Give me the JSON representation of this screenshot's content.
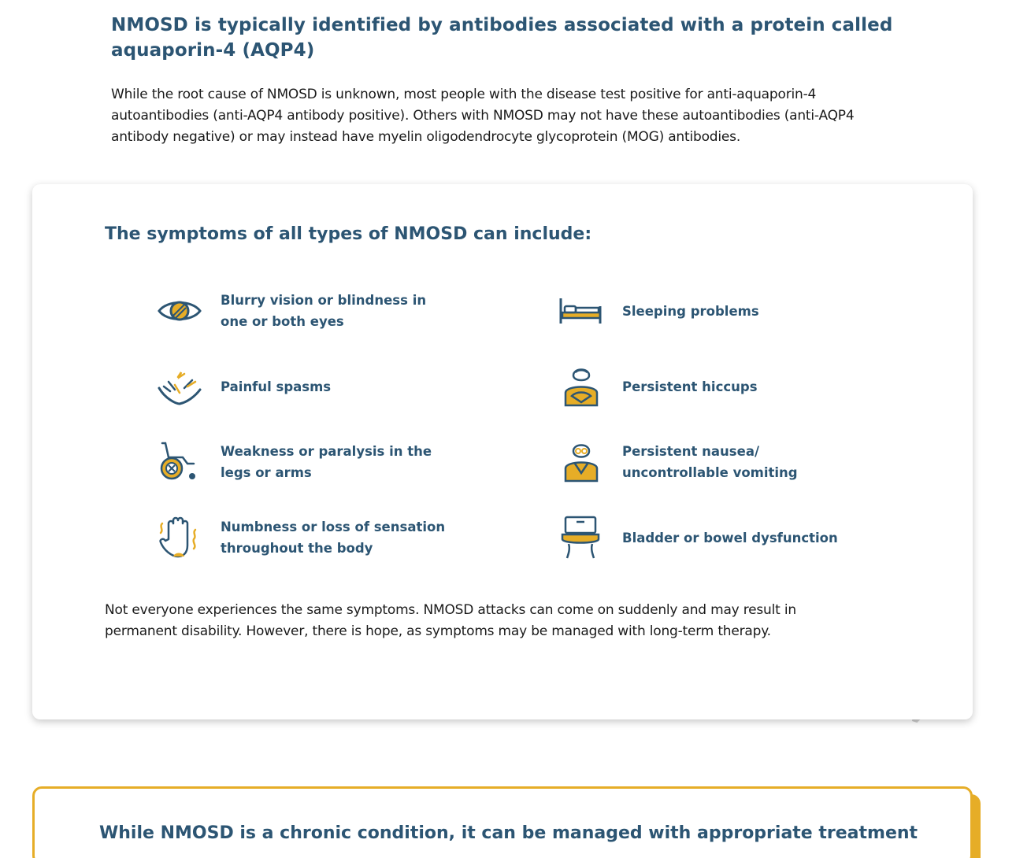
{
  "intro": {
    "heading": "NMOSD is typically identified by antibodies associated with a protein called aquaporin-4 (AQP4)",
    "body": "While the root cause of NMOSD is unknown, most people with the disease test positive for anti-aquaporin-4 autoantibodies (anti-AQP4 antibody positive). Others with NMOSD may not have these autoantibodies (anti-AQP4 antibody negative) or may instead have myelin oligodendrocyte glycoprotein (MOG) antibodies."
  },
  "symptoms_card": {
    "heading": "The symptoms of all types of NMOSD can include:",
    "items": [
      {
        "label": "Blurry vision or blindness in one or both eyes",
        "icon": "eye-icon"
      },
      {
        "label": "Sleeping problems",
        "icon": "bed-icon"
      },
      {
        "label": "Painful spasms",
        "icon": "spasm-icon"
      },
      {
        "label": "Persistent hiccups",
        "icon": "hiccup-person-icon"
      },
      {
        "label": "Weakness or paralysis in the legs or arms",
        "icon": "wheelchair-icon"
      },
      {
        "label": "Persistent nausea/ uncontrollable vomiting",
        "icon": "nausea-person-icon"
      },
      {
        "label": "Numbness or loss of sensation throughout the body",
        "icon": "hand-icon"
      },
      {
        "label": "Bladder or bowel dysfunction",
        "icon": "toilet-icon"
      }
    ],
    "note": "Not everyone experiences the same symptoms. NMOSD attacks can come on suddenly and may result in permanent disability. However, there is hope, as symptoms may be managed with long-term therapy."
  },
  "management_box": {
    "heading": "While NMOSD is a chronic condition, it can be managed with appropriate treatment"
  },
  "colors": {
    "heading": "#2c5573",
    "accent": "#e6ad27",
    "text": "#1a1a1a"
  }
}
